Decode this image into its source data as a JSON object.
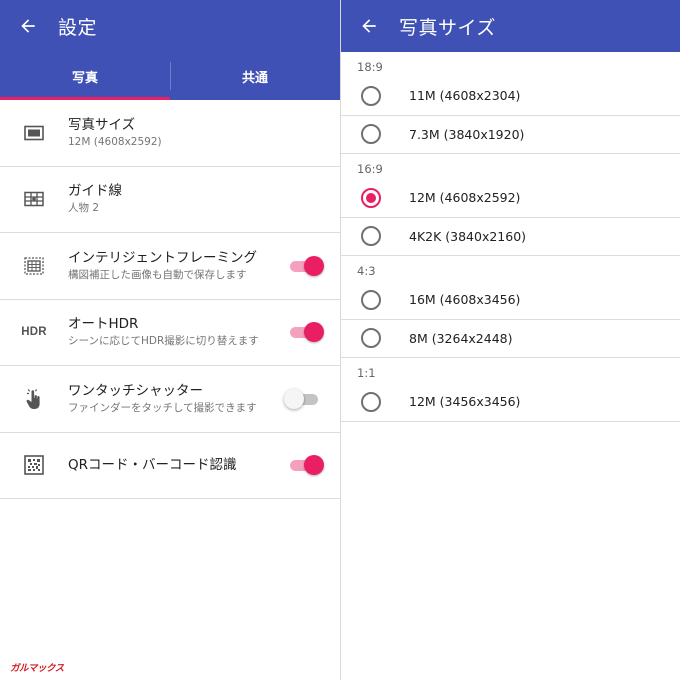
{
  "left": {
    "title": "設定",
    "tabs": [
      {
        "label": "写真",
        "active": true
      },
      {
        "label": "共通",
        "active": false
      }
    ],
    "settings": [
      {
        "icon": "picture-size-icon",
        "label": "写真サイズ",
        "sub": "12M (4608x2592)"
      },
      {
        "icon": "grid-lines-icon",
        "label": "ガイド線",
        "sub": "人物 2"
      },
      {
        "icon": "intelligent-framing-icon",
        "label": "インテリジェントフレーミング",
        "sub": "構図補正した画像も自動で保存します",
        "toggle": "on"
      },
      {
        "icon": "hdr-icon",
        "icon_text": "HDR",
        "label": "オートHDR",
        "sub": "シーンに応じてHDR撮影に切り替えます",
        "toggle": "on"
      },
      {
        "icon": "touch-icon",
        "label": "ワンタッチシャッター",
        "sub": "ファインダーをタッチして撮影できます",
        "toggle": "off"
      },
      {
        "icon": "qr-code-icon",
        "label": "QRコード・バーコード認識",
        "toggle": "on"
      }
    ]
  },
  "right": {
    "title": "写真サイズ",
    "groups": [
      {
        "header": "18:9",
        "options": [
          {
            "label": "11M (4608x2304)",
            "selected": false
          },
          {
            "label": "7.3M (3840x1920)",
            "selected": false
          }
        ]
      },
      {
        "header": "16:9",
        "options": [
          {
            "label": "12M (4608x2592)",
            "selected": true
          },
          {
            "label": "4K2K (3840x2160)",
            "selected": false
          }
        ]
      },
      {
        "header": "4:3",
        "options": [
          {
            "label": "16M (4608x3456)",
            "selected": false
          },
          {
            "label": "8M (3264x2448)",
            "selected": false
          }
        ]
      },
      {
        "header": "1:1",
        "options": [
          {
            "label": "12M (3456x3456)",
            "selected": false
          }
        ]
      }
    ]
  },
  "watermark": "ガルマックス",
  "colors": {
    "app_bar": "#3f51b5",
    "accent": "#e91e63",
    "divider": "#dcdcdc",
    "watermark": "#d21f26"
  }
}
